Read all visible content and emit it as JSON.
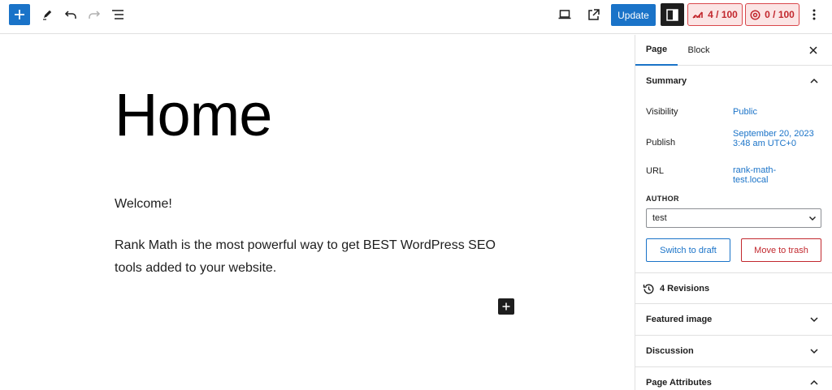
{
  "toolbar": {
    "update_label": "Update",
    "rankmath_score": "4 / 100",
    "ai_score": "0 / 100"
  },
  "editor": {
    "title": "Home",
    "paragraphs": [
      "Welcome!",
      "Rank Math is the most powerful way to get BEST WordPress SEO tools added to your website."
    ]
  },
  "sidebar": {
    "tabs": [
      "Page",
      "Block"
    ],
    "summary": {
      "heading": "Summary",
      "visibility_label": "Visibility",
      "visibility_value": "Public",
      "publish_label": "Publish",
      "publish_value": "September 20, 2023 3:48 am UTC+0",
      "url_label": "URL",
      "url_value": "rank-math-test.local",
      "author_label": "AUTHOR",
      "author_value": "test",
      "switch_draft_label": "Switch to draft",
      "move_trash_label": "Move to trash"
    },
    "revisions_label": "4 Revisions",
    "panels": [
      "Featured image",
      "Discussion",
      "Page Attributes"
    ]
  },
  "colors": {
    "accent": "#1a73c8",
    "danger": "#c2282e",
    "score_bg": "#fbe5e5"
  }
}
